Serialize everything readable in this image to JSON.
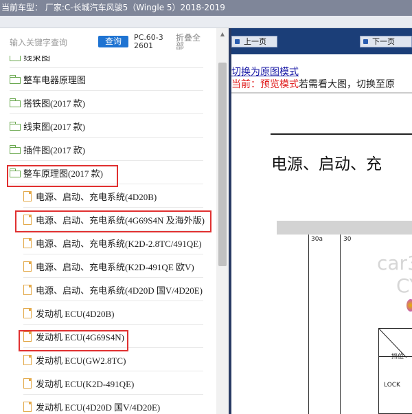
{
  "header": {
    "title": "当前车型： 厂家:C-长城汽车风骏5（Wingle 5）2018-2019"
  },
  "search": {
    "placeholder": "输入关键字查询",
    "button_label": "查询",
    "code": "PC.60-32601",
    "collapse_label": "折叠全部"
  },
  "tree": {
    "folders": [
      {
        "label": "线束图"
      },
      {
        "label": "整车电器原理图"
      },
      {
        "label": "搭铁图(2017 款)"
      },
      {
        "label": "线束图(2017 款)"
      },
      {
        "label": "插件图(2017 款)"
      },
      {
        "label": "整车原理图(2017 款)"
      }
    ],
    "docs": [
      {
        "label": "电源、启动、充电系统(4D20B)"
      },
      {
        "label": "电源、启动、充电系统(4G69S4N 及海外版)"
      },
      {
        "label": "电源、启动、充电系统(K2D-2.8TC/491QE)"
      },
      {
        "label": "电源、启动、充电系统(K2D-491QE 欧V)"
      },
      {
        "label": "电源、启动、充电系统(4D20D 国V/4D20E)"
      },
      {
        "label": "发动机 ECU(4D20B)"
      },
      {
        "label": "发动机 ECU(4G69S4N)"
      },
      {
        "label": "发动机 ECU(GW2.8TC)"
      },
      {
        "label": "发动机 ECU(K2D-491QE)"
      },
      {
        "label": "发动机 ECU(4D20D 国V/4D20E)"
      }
    ]
  },
  "viewer": {
    "prev_label": "上一页",
    "next_label": "下一页",
    "switch_link": "切换为原图模式",
    "status_prefix": "当前：预览模式",
    "status_suffix": "若需看大图，切换至原",
    "doc_title": "电源、启动、充",
    "wire_labels": [
      "30a",
      "30"
    ],
    "watermark": [
      "car3",
      "CY"
    ],
    "diagram_labels": [
      "挡位",
      "LOCK"
    ]
  },
  "colors": {
    "title_bar": "#7f8699",
    "nav_bar": "#1b3e78",
    "search_button": "#1e73d2",
    "highlight": "#e03030",
    "status_red": "#e02020"
  }
}
